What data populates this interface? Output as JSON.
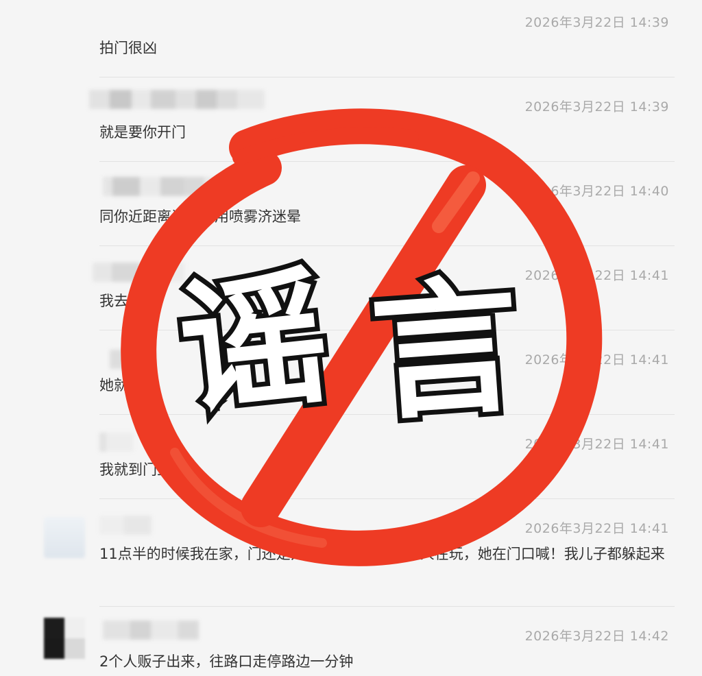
{
  "messages": [
    {
      "time": "2026年3月22日 14:39",
      "text": "拍门很凶"
    },
    {
      "time": "2026年3月22日 14:39",
      "text": "就是要你开门"
    },
    {
      "time": "2026年3月22日 14:40",
      "text": "同你近距离说话或用喷雾济迷晕"
    },
    {
      "time": "2026年3月22日 14:41",
      "text": "我去拿"
    },
    {
      "time": "2026年3月22日 14:41",
      "text": "她就跑了"
    },
    {
      "time": "2026年3月22日 14:41",
      "text": "我就到门卫等"
    },
    {
      "time": "2026年3月22日 14:41",
      "text": "11点半的时候我在家，门还是开着的，我儿子一个人在玩，她在门口喊！我儿子都躲起来"
    },
    {
      "time": "2026年3月22日 14:42",
      "text": "2个人贩子出来，往路口走停路边一分钟"
    }
  ],
  "stamp": {
    "char_1": "谣",
    "char_2": "言",
    "color": "#ee3b24"
  }
}
